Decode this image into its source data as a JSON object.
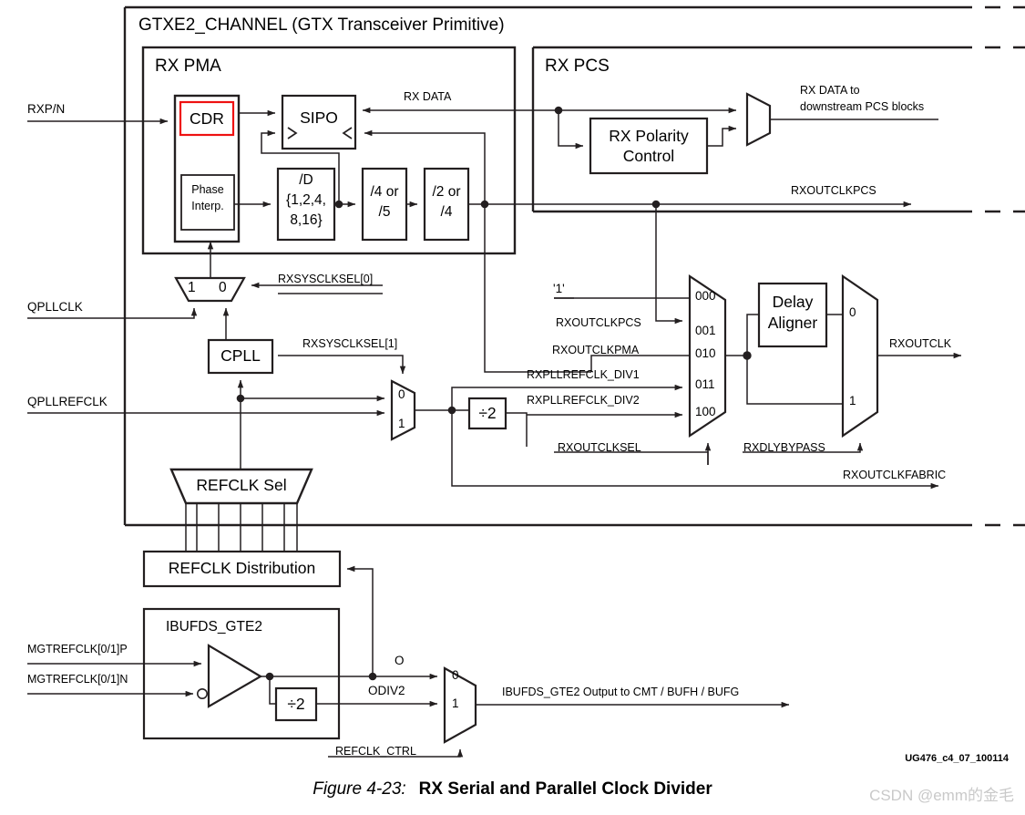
{
  "figure": {
    "number": "Figure 4-23:",
    "title": "RX Serial and Parallel Clock Divider",
    "doc_code": "UG476_c4_07_100114",
    "watermark": "CSDN @emm的金毛"
  },
  "containers": {
    "channel": "GTXE2_CHANNEL (GTX Transceiver Primitive)",
    "rx_pma": "RX PMA",
    "rx_pcs": "RX PCS"
  },
  "blocks": {
    "cdr": "CDR",
    "phase_interp_l1": "Phase",
    "phase_interp_l2": "Interp.",
    "sipo": "SIPO",
    "div_d_l1": "/D",
    "div_d_l2": "{1,2,4,",
    "div_d_l3": "8,16}",
    "div45_l1": "/4 or",
    "div45_l2": "/5",
    "div24_l1": "/2 or",
    "div24_l2": "/4",
    "rx_polarity_l1": "RX Polarity",
    "rx_polarity_l2": "Control",
    "cpll": "CPLL",
    "refclk_sel": "REFCLK Sel",
    "refclk_dist": "REFCLK Distribution",
    "ibufds": "IBUFDS_GTE2",
    "delay_aligner_l1": "Delay",
    "delay_aligner_l2": "Aligner",
    "div2_mid": "÷2",
    "div2_bot": "÷2"
  },
  "signals": {
    "rxpn": "RXP/N",
    "qpllclk": "QPLLCLK",
    "qpllrefclk": "QPLLREFCLK",
    "rx_data": "RX DATA",
    "rx_data_down_l1": "RX DATA to",
    "rx_data_down_l2": "downstream PCS blocks",
    "rxoutclkpcs_out": "RXOUTCLKPCS",
    "rxsysclksel0": "RXSYSCLKSEL[0]",
    "rxsysclksel1": "RXSYSCLKSEL[1]",
    "one_const": "'1'",
    "rxoutclkpcs_in": "RXOUTCLKPCS",
    "rxoutclkpma": "RXOUTCLKPMA",
    "rxpllrefclk_div1": "RXPLLREFCLK_DIV1",
    "rxpllrefclk_div2": "RXPLLREFCLK_DIV2",
    "rxoutclksel": "RXOUTCLKSEL",
    "rxdlybypass": "RXDLYBYPASS",
    "rxoutclk": "RXOUTCLK",
    "rxoutclkfabric": "RXOUTCLKFABRIC",
    "mgtrefclk_p": "MGTREFCLK[0/1]P",
    "mgtrefclk_n": "MGTREFCLK[0/1]N",
    "o_port": "O",
    "odiv2_port": "ODIV2",
    "refclk_ctrl": "REFCLK_CTRL",
    "ibufds_out": "IBUFDS_GTE2   Output to CMT / BUFH / BUFG"
  },
  "mux_labels": {
    "sysclk_one": "1",
    "sysclk_zero": "0",
    "sel1_zero": "0",
    "sel1_one": "1",
    "outclk_000": "000",
    "outclk_001": "001",
    "outclk_010": "010",
    "outclk_011": "011",
    "outclk_100": "100",
    "dly_zero": "0",
    "dly_one": "1",
    "refclk_zero": "0",
    "refclk_one": "1"
  },
  "colors": {
    "highlight": "#ee1111",
    "line": "#231f20",
    "text": "#000000",
    "watermark": "#c9c9c9"
  }
}
